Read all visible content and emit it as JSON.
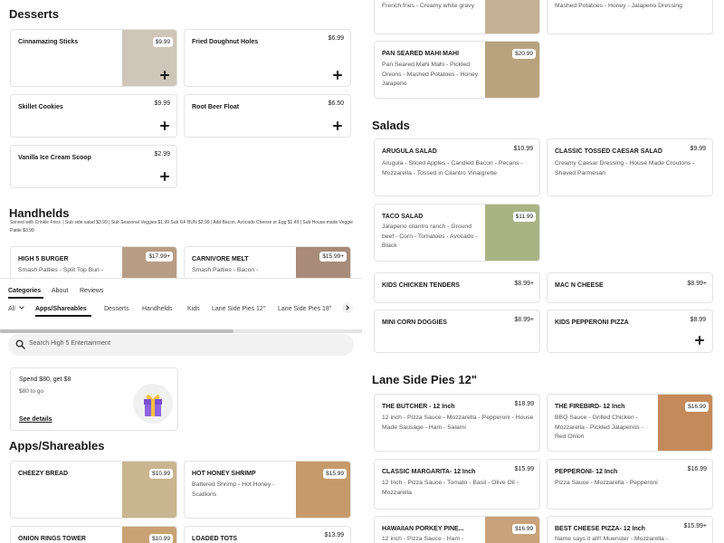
{
  "left": {
    "desserts": {
      "title": "Desserts",
      "items": [
        {
          "name": "Cinnamazing Sticks",
          "price": "$9.99"
        },
        {
          "name": "Fried Doughnut Holes",
          "price": "$6.99"
        },
        {
          "name": "Skillet Cookies",
          "price": "$9.99"
        },
        {
          "name": "Root Beer Float",
          "price": "$6.50"
        },
        {
          "name": "Vanilla Ice Cream Scoop",
          "price": "$2.99"
        }
      ]
    },
    "handhelds": {
      "title": "Handhelds",
      "subtitle": "Served with Crinkle Fries. | Sub side salad $3.99 | Sub Seasonal Veggies $1.99 Sub GF BUN $2.99 | Add Bacon, Avocado Cheese or Egg $1.49 | Sub House-made Veggie Pattie $3.99",
      "items": [
        {
          "name": "HIGH 5 BURGER",
          "price": "$17.99+",
          "desc": "Smash Patties - Split Top Bun -"
        },
        {
          "name": "CARNIVORE MELT",
          "price": "$15.99+",
          "desc": "Smash Patties - Bacon -"
        }
      ]
    },
    "nav": {
      "tabs": [
        "Categories",
        "About",
        "Reviews"
      ],
      "all_label": "All",
      "categories": [
        "Apps/Shareables",
        "Desserts",
        "Handhelds",
        "Kids",
        "Lane Side Pies 12\"",
        "Lane Side Pies 18\""
      ]
    },
    "search": {
      "placeholder": "Search High 5 Entertainment"
    },
    "promo": {
      "line1": "Spend $80, get $8",
      "line2": "$80 to go",
      "link": "See details"
    },
    "apps": {
      "title": "Apps/Shareables",
      "items": [
        {
          "name": "CHEEZY BREAD",
          "price": "$10.99",
          "desc": ""
        },
        {
          "name": "HOT HONEY SHRIMP",
          "price": "$15.99",
          "desc": "Battered Shrimp - Hot Honey - Scallions"
        },
        {
          "name": "ONION RINGS TOWER",
          "price": "$10.99",
          "desc": ""
        },
        {
          "name": "LOADED TOTS",
          "price": "$13.99",
          "desc": ""
        }
      ]
    }
  },
  "right": {
    "top_items": [
      {
        "name": "",
        "price": "",
        "desc": "House Battered Chicken tenders - French fries - Creamy white gravy"
      },
      {
        "name": "",
        "price": "",
        "desc": "Honey Jalapeño Pork Steak - Parmesan Onions - Mashed Potatoes - Honey - Jalapeno Dressing"
      },
      {
        "name": "PAN SEARED MAHI MAHI",
        "price": "$20.99",
        "desc": "Pan Seared Mahi Mahi - Pickled Onions - Mashed Potatoes - Honey Jalapeno"
      }
    ],
    "salads": {
      "title": "Salads",
      "items": [
        {
          "name": "ARUGULA SALAD",
          "price": "$10.99",
          "desc": "Arugula - Sliced Apples - Candied Bacon - Pecans - Mozzarella - Tossed in Cilantro Vinaigrette"
        },
        {
          "name": "CLASSIC TOSSED CAESAR SALAD",
          "price": "$9.99",
          "desc": "Creamy Caesar Dressing - House Made Croutons - Shaved Parmesan"
        },
        {
          "name": "TACO SALAD",
          "price": "$11.99",
          "desc": "Jalapeno cilantro ranch - Ground beef - Corn - Tomatoes - Avocado - Black"
        }
      ]
    },
    "kids": {
      "items": [
        {
          "name": "KIDS CHICKEN TENDERS",
          "price": "$8.99+"
        },
        {
          "name": "MAC N CHEESE",
          "price": "$8.99+"
        },
        {
          "name": "MINI CORN DOGGIES",
          "price": "$8.99+"
        },
        {
          "name": "KIDS PEPPERONI PIZZA",
          "price": "$8.99"
        }
      ]
    },
    "pies": {
      "title": "Lane Side Pies 12\"",
      "items": [
        {
          "name": "THE BUTCHER - 12 Inch",
          "price": "$18.99",
          "desc": "12 inch - Pizza Sauce - Mozzarella - Pepperoni - House Made Sausage - Ham - Salami"
        },
        {
          "name": "THE FIREBIRD- 12 Inch",
          "price": "$16.99",
          "desc": "BBQ Sauce - Grilled Chicken - Mozzarella - Pickled Jalapenos - Red Onion"
        },
        {
          "name": "CLASSIC MARGARITA- 12 Inch",
          "price": "$15.99",
          "desc": "12 Inch - Pizza Sauce - Tomato - Basil - Olive Oil - Mozzarella"
        },
        {
          "name": "PEPPERONI- 12 Inch",
          "price": "$16.99",
          "desc": "Pizza Sauce - Mozzarella - Pepperoni"
        },
        {
          "name": "HAWAIIAN PORKEY PINE...",
          "price": "$16.99",
          "desc": "12 inch - Pizza Sauce - Ham -"
        },
        {
          "name": "BEST CHEESE PIZZA- 12 Inch",
          "price": "$15.99+",
          "desc": "Name says it all!! Muenster - Mozzarella -"
        }
      ]
    }
  }
}
